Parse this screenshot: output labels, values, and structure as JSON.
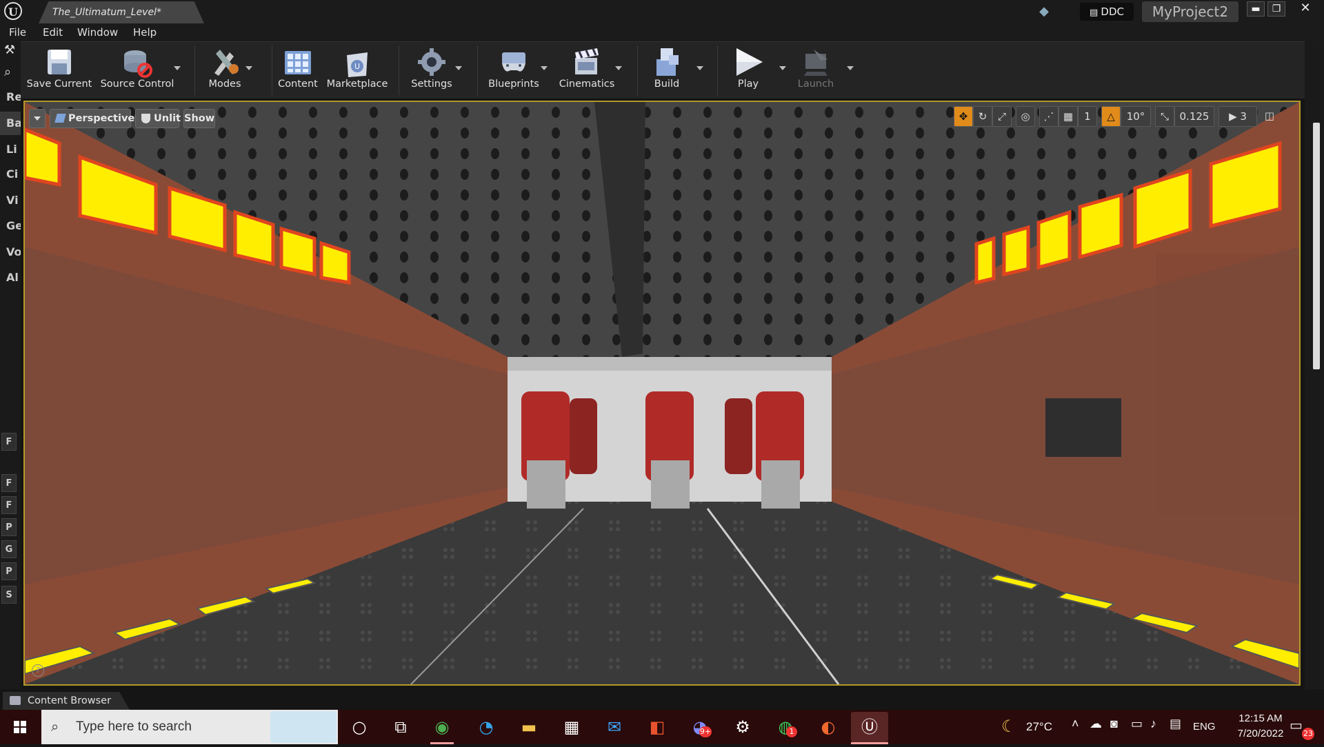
{
  "titlebar": {
    "document_tab": "The_Ultimatum_Level*",
    "ddc_label": "DDC",
    "project_name": "MyProject2",
    "min_glyph": "▬",
    "max_glyph": "❐",
    "close_glyph": "✕"
  },
  "menu": {
    "items": [
      "File",
      "Edit",
      "Window",
      "Help"
    ]
  },
  "left_tabs": [
    "Re",
    "Ba",
    "Li",
    "Ci",
    "Vi",
    "Ge",
    "Vo",
    "Al"
  ],
  "toolbar": {
    "save": "Save Current",
    "source_control": "Source Control",
    "modes": "Modes",
    "content": "Content",
    "marketplace": "Marketplace",
    "settings": "Settings",
    "blueprints": "Blueprints",
    "cinematics": "Cinematics",
    "build": "Build",
    "play": "Play",
    "launch": "Launch"
  },
  "viewport": {
    "view_mode": "Perspective",
    "lighting_mode": "Unlit",
    "show_label": "Show",
    "grid_size": "1",
    "rotation_snap": "10°",
    "scale_snap": "0.125",
    "camera_speed": "3",
    "active_tool": "translate",
    "accent_color": "#e08b1a"
  },
  "right_tabs": [
    "F",
    "F",
    "F",
    "P",
    "G",
    "P",
    "S"
  ],
  "bottom": {
    "content_browser": "Content Browser"
  },
  "taskbar": {
    "search_placeholder": "Type here to search",
    "weather": "27°C",
    "language": "ENG",
    "time": "12:15 AM",
    "date": "7/20/2022",
    "notification_count": "23",
    "whatsapp_badge": "1",
    "chat_badge": "9+"
  }
}
